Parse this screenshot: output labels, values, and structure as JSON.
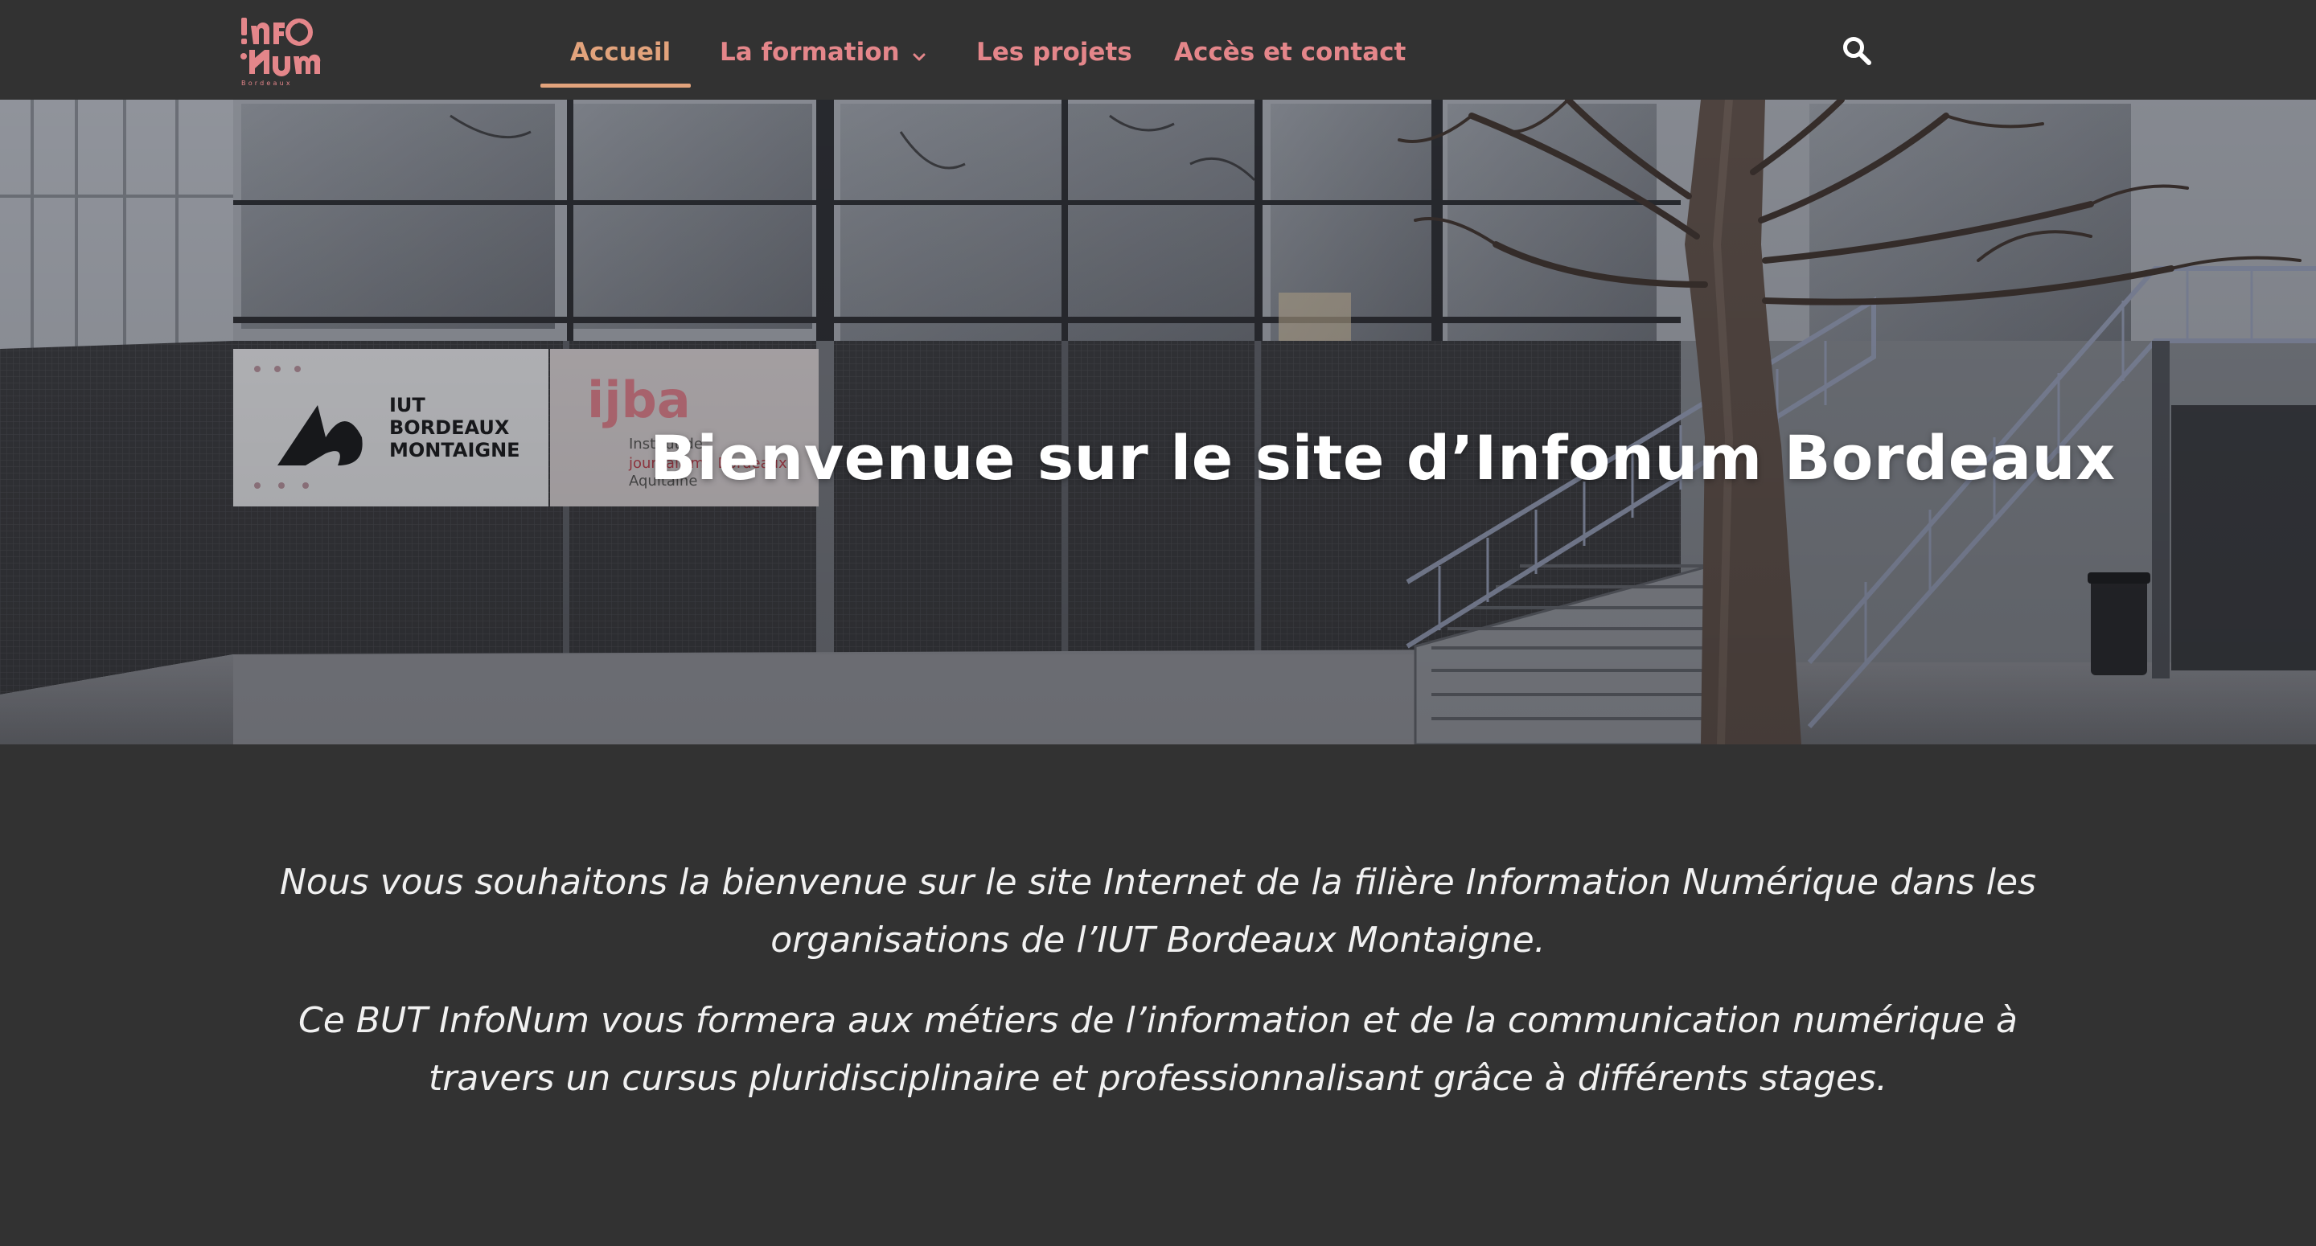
{
  "header": {
    "logo_alt": "InfoNum Bordeaux",
    "logo_lines": [
      "!nfo",
      "Num",
      "Bordeaux"
    ],
    "nav": [
      {
        "label": "Accueil",
        "active": true
      },
      {
        "label": "La formation",
        "has_dropdown": true
      },
      {
        "label": "Les projets"
      },
      {
        "label": "Accès et contact"
      }
    ],
    "search_icon": "search-icon"
  },
  "hero": {
    "title": "Bienvenue sur le site d’Infonum Bordeaux",
    "sign_iut": [
      "IUT",
      "BORDEAUX",
      "MONTAIGNE"
    ],
    "sign_ijba": [
      "ijba",
      "Institut de",
      "journalisme Bordeaux",
      "Aquitaine"
    ]
  },
  "intro": {
    "paragraph_1": "Nous vous souhaitons la bienvenue sur le site Internet de la filière Information Numérique dans les organisations de l’IUT Bordeaux Montaigne.",
    "paragraph_2": "Ce BUT InfoNum vous formera aux métiers de l’information et de la communication numérique à travers un cursus pluridisciplinaire et professionnalisant grâce à différents stages."
  },
  "colors": {
    "background": "#323232",
    "nav_link": "#e4868a",
    "nav_active": "#e2a37c",
    "text": "#f1f1f1"
  }
}
